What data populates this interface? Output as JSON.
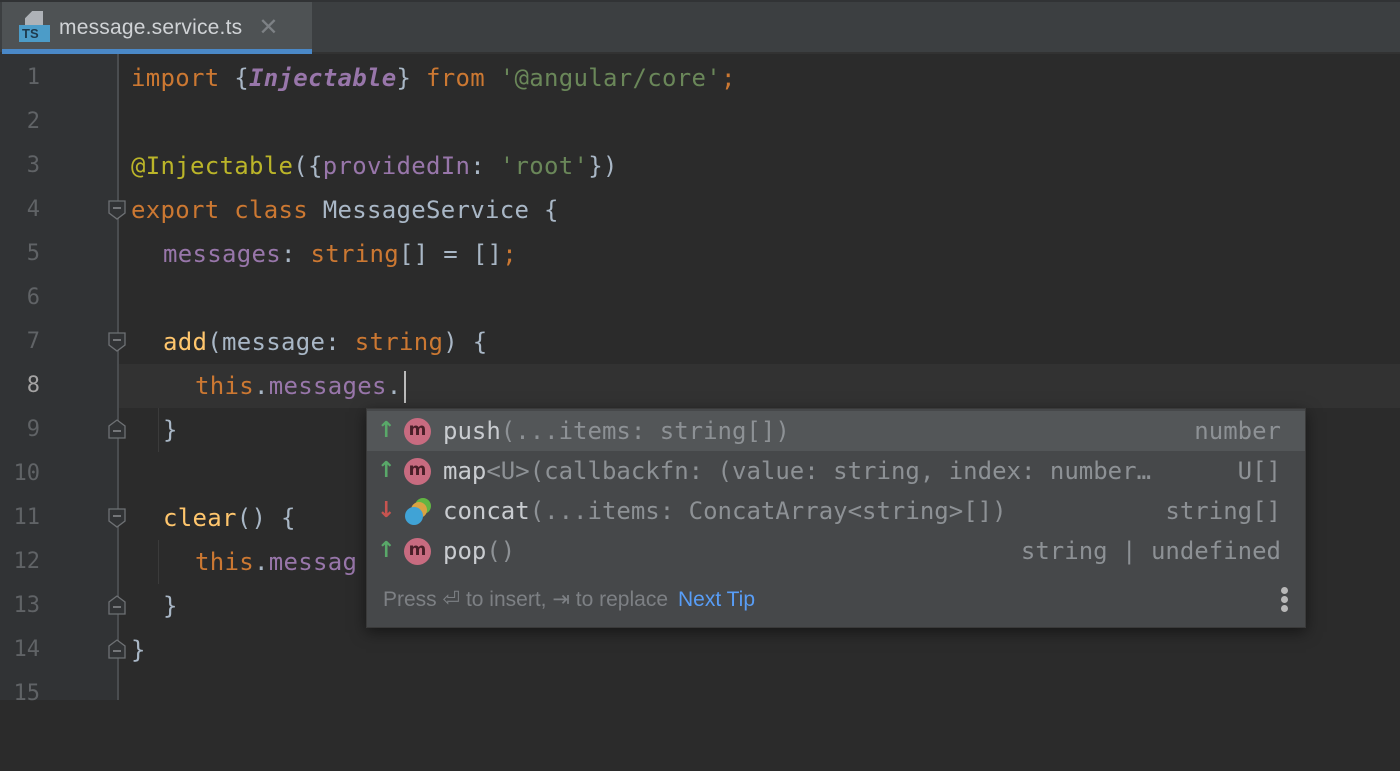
{
  "tab": {
    "icon": "typescript-file-icon",
    "icon_badge": "TS",
    "filename": "message.service.ts",
    "close_glyph": "✕",
    "accent_color": "#4a88c7"
  },
  "editor": {
    "current_line": 8,
    "line_numbers": [
      "1",
      "2",
      "3",
      "4",
      "5",
      "6",
      "7",
      "8",
      "9",
      "10",
      "11",
      "12",
      "13",
      "14",
      "15"
    ],
    "lines": {
      "l1": {
        "import": "import ",
        "open": "{",
        "name": "Injectable",
        "close": "}",
        "from": " from ",
        "module": "'@angular/core'",
        "semi": ";"
      },
      "l3": {
        "decorator": "@Injectable",
        "open": "({",
        "key": "providedIn",
        "colon": ": ",
        "value": "'root'",
        "close": "})"
      },
      "l4": {
        "export": "export ",
        "class": "class ",
        "name": "MessageService",
        "brace": " {"
      },
      "l5": {
        "field": "messages",
        "colon": ": ",
        "type": "string",
        "rest": "[] = []",
        "semi": ";"
      },
      "l7": {
        "method": "add",
        "open": "(",
        "param": "message",
        "colon": ": ",
        "type": "string",
        "close": ") {"
      },
      "l8": {
        "this": "this",
        "dot": ".",
        "field": "messages",
        "dot2": "."
      },
      "l9": {
        "text": "}"
      },
      "l11": {
        "method": "clear",
        "rest": "() {"
      },
      "l12": {
        "this": "this",
        "dot": ".",
        "field": "messag"
      },
      "l13": {
        "text": "}"
      },
      "l14": {
        "text": "}"
      }
    }
  },
  "completion": {
    "items": [
      {
        "name": "push",
        "signature": "(...items: string[])",
        "return_type": "number",
        "icon": "method-icon",
        "icon_letter": "m",
        "rank": "up",
        "selected": true
      },
      {
        "name": "map",
        "signature": "<U>(callbackfn: (value: string, index: number…",
        "return_type": "U[]",
        "icon": "method-icon",
        "icon_letter": "m",
        "rank": "up",
        "selected": false
      },
      {
        "name": "concat",
        "signature": "(...items: ConcatArray<string>[])",
        "return_type": "string[]",
        "icon": "overloads-icon",
        "icon_letter": "",
        "rank": "down",
        "selected": false
      },
      {
        "name": "pop",
        "signature": "()",
        "return_type": "string | undefined",
        "icon": "method-icon",
        "icon_letter": "m",
        "rank": "up",
        "selected": false
      }
    ],
    "arrow_up": "↑",
    "arrow_down": "↓",
    "footer": {
      "press": "Press ",
      "enter_glyph": "⏎",
      "to_insert": " to insert, ",
      "tab_glyph": "⇥",
      "to_replace": " to replace",
      "next_tip": "Next Tip"
    }
  }
}
